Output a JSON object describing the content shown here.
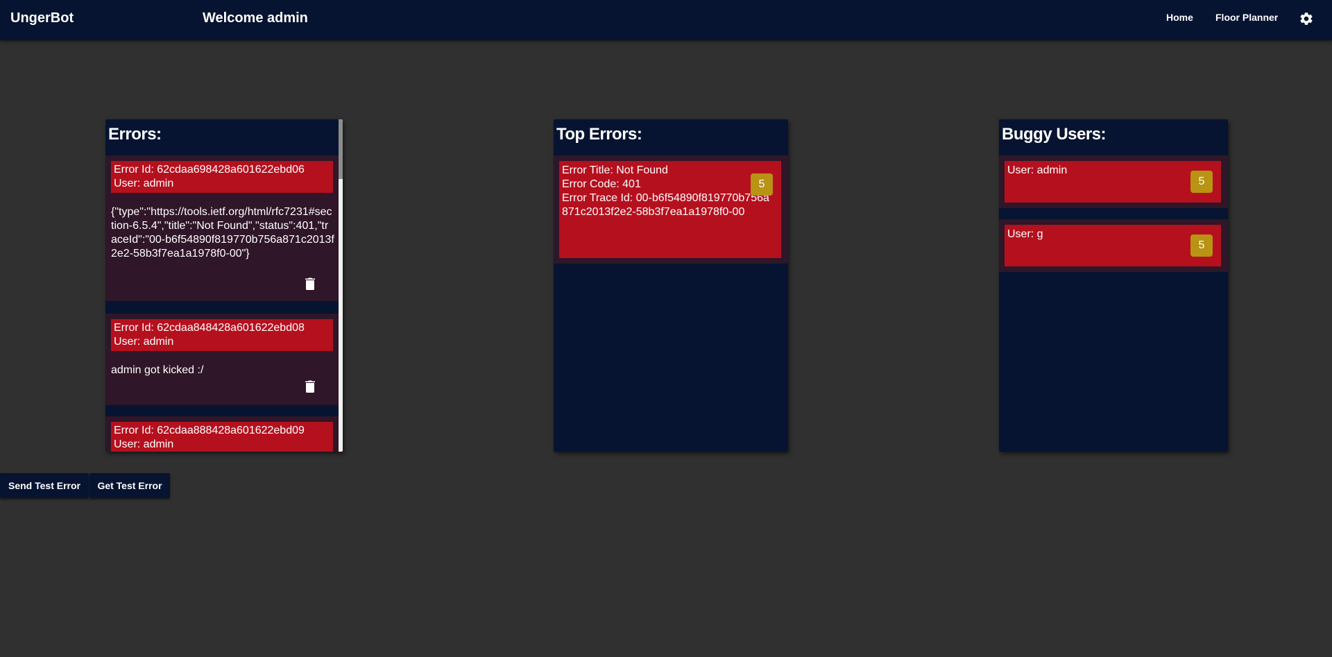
{
  "header": {
    "brand": "UngerBot",
    "welcome": "Welcome admin",
    "nav": {
      "home": "Home",
      "floor_planner": "Floor Planner"
    },
    "settings_icon": "gear-icon"
  },
  "errors_panel": {
    "title": "Errors:",
    "items": [
      {
        "id_line": "Error Id: 62cdaa698428a601622ebd06",
        "user_line": "User: admin",
        "body": "{\"type\":\"https://tools.ietf.org/html/rfc7231#section-6.5.4\",\"title\":\"Not Found\",\"status\":401,\"traceId\":\"00-b6f54890f819770b756a871c2013f2e2-58b3f7ea1a1978f0-00\"}"
      },
      {
        "id_line": "Error Id: 62cdaa848428a601622ebd08",
        "user_line": "User: admin",
        "body": "admin got kicked :/"
      },
      {
        "id_line": "Error Id: 62cdaa888428a601622ebd09",
        "user_line": "User: admin",
        "body": ""
      }
    ]
  },
  "top_errors_panel": {
    "title": "Top Errors:",
    "items": [
      {
        "title_line": "Error Title: Not Found",
        "code_line": "Error Code: 401",
        "trace_line": "Error Trace Id: 00-b6f54890f819770b756a871c2013f2e2-58b3f7ea1a1978f0-00",
        "count": "5"
      }
    ]
  },
  "buggy_users_panel": {
    "title": "Buggy Users:",
    "items": [
      {
        "user_line": "User: admin",
        "count": "5"
      },
      {
        "user_line": "User: g",
        "count": "5"
      }
    ]
  },
  "actions": {
    "send_test_error": "Send Test Error",
    "get_test_error": "Get Test Error"
  },
  "colors": {
    "background": "#303030",
    "navbar": "#061431",
    "panel": "#061431",
    "card": "#2f1628",
    "error_red": "#b5101e",
    "badge_gold": "#b89314"
  }
}
